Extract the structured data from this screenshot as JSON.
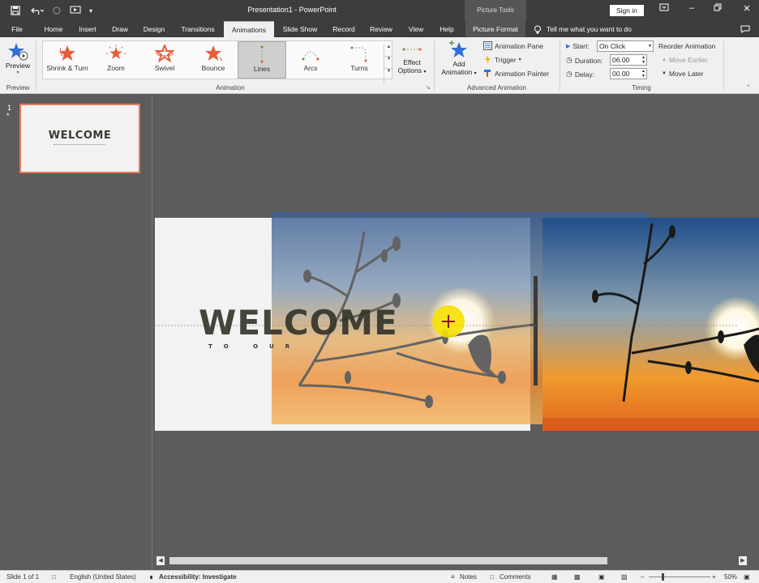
{
  "window": {
    "title": "Presentation1 - PowerPoint",
    "contextual_tab_group": "Picture Tools",
    "signin_label": "Sign in"
  },
  "tabs": [
    {
      "label": "File"
    },
    {
      "label": "Home"
    },
    {
      "label": "Insert"
    },
    {
      "label": "Draw"
    },
    {
      "label": "Design"
    },
    {
      "label": "Transitions"
    },
    {
      "label": "Animations",
      "active": true
    },
    {
      "label": "Slide Show"
    },
    {
      "label": "Record"
    },
    {
      "label": "Review"
    },
    {
      "label": "View"
    },
    {
      "label": "Help"
    },
    {
      "label": "Picture Format"
    }
  ],
  "tell_me": "Tell me what you want to do",
  "ribbon": {
    "preview": {
      "button": "Preview",
      "group": "Preview"
    },
    "animation": {
      "group": "Animation",
      "items": [
        {
          "label": "Shrink & Turn",
          "icon": "star-shrink-icon"
        },
        {
          "label": "Zoom",
          "icon": "star-zoom-icon"
        },
        {
          "label": "Swivel",
          "icon": "star-swivel-icon"
        },
        {
          "label": "Bounce",
          "icon": "star-bounce-icon"
        },
        {
          "label": "Lines",
          "icon": "motion-line-icon",
          "selected": true
        },
        {
          "label": "Arcs",
          "icon": "motion-arc-icon"
        },
        {
          "label": "Turns",
          "icon": "motion-turn-icon"
        }
      ],
      "effect_options_line1": "Effect",
      "effect_options_line2": "Options"
    },
    "advanced": {
      "group": "Advanced Animation",
      "add_line1": "Add",
      "add_line2": "Animation",
      "pane": "Animation Pane",
      "trigger": "Trigger",
      "painter": "Animation Painter"
    },
    "timing": {
      "group": "Timing",
      "start_label": "Start:",
      "start_value": "On Click",
      "duration_label": "Duration:",
      "duration_value": "06.00",
      "delay_label": "Delay:",
      "delay_value": "00.00",
      "reorder": "Reorder Animation",
      "move_earlier": "Move Earlier",
      "move_later": "Move Later"
    }
  },
  "thumbnail": {
    "number": "1",
    "star": "*",
    "title": "WELCOME"
  },
  "slide": {
    "title": "WELCOME",
    "subtitle": "TO OUR"
  },
  "status": {
    "slide": "Slide 1 of 1",
    "language": "English (United States)",
    "accessibility": "Accessibility: Investigate",
    "notes": "Notes",
    "comments": "Comments",
    "zoom": "50%"
  },
  "colors": {
    "accent": "#d35230",
    "ribbon_bg": "#f0f0f0",
    "titlebar_bg": "#3d3d3d",
    "workspace_bg": "#5c5c5c",
    "cursor_highlight": "#f5e000"
  }
}
